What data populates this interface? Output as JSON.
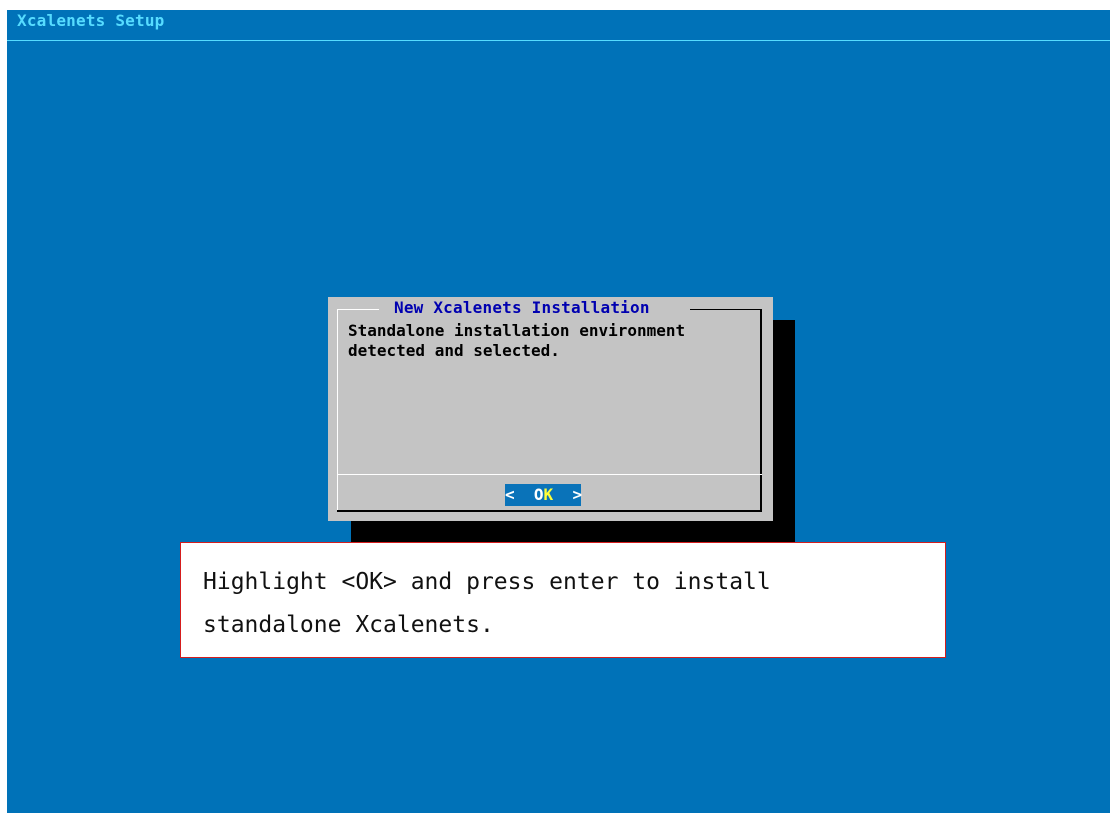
{
  "screen": {
    "title": "Xcalenets Setup",
    "background_color": "#0072b8"
  },
  "dialog": {
    "title": "New Xcalenets Installation",
    "message_lines": [
      "Standalone installation environment",
      "detected and selected."
    ],
    "ok_button": {
      "left_bracket": "<",
      "label_prefix": "O",
      "hotkey": "K",
      "right_bracket": ">"
    }
  },
  "annotation": {
    "lines": [
      "Highlight <OK> and press enter to install",
      "standalone Xcalenets."
    ],
    "border_color": "#d51d1d"
  }
}
